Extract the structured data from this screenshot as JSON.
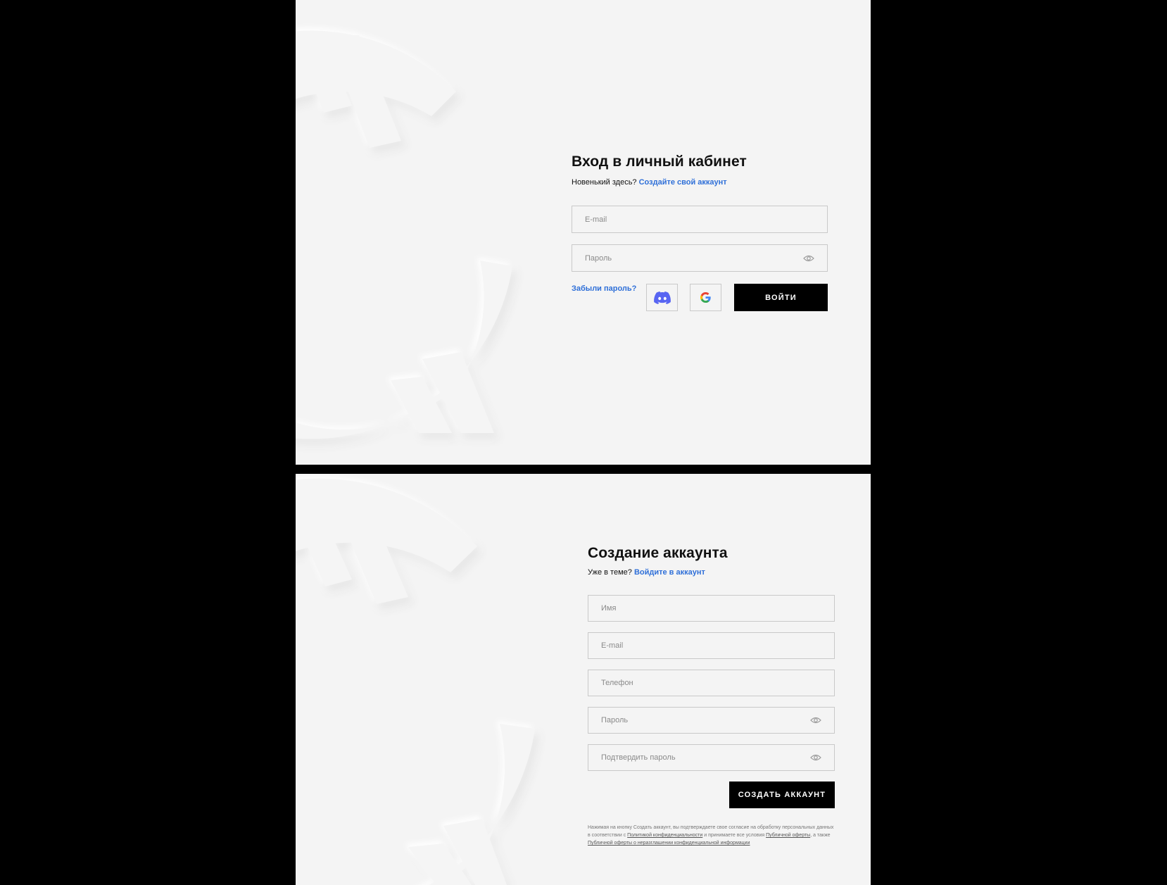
{
  "login": {
    "title": "Вход в личный кабинет",
    "subtitle_text": "Новенький здесь? ",
    "subtitle_link": "Создайте свой аккаунт",
    "email_placeholder": "E-mail",
    "password_placeholder": "Пароль",
    "forgot_link": "Забыли пароль?",
    "social_buttons": [
      "discord-icon",
      "google-icon"
    ],
    "submit_label": "ВОЙТИ"
  },
  "register": {
    "title": "Создание аккаунта",
    "subtitle_text": "Уже в теме? ",
    "subtitle_link": "Войдите в аккаунт",
    "name_placeholder": "Имя",
    "email_placeholder": "E-mail",
    "phone_placeholder": "Телефон",
    "password_placeholder": "Пароль",
    "confirm_placeholder": "Подтвердить пароль",
    "submit_label": "СОЗДАТЬ АККАУНТ",
    "legal": {
      "part1": "Нажимая на кнопку Создать аккаунт, вы подтверждаете свое согласие на обработку персональных данных в соответствии с ",
      "privacy_link": "Политикой конфиденциальности",
      "part2": " и принимаете все условия ",
      "offer_link": "Публичной оферты",
      "part3": ", а также ",
      "nda_link": "Публичной оферты о неразглашении конфиденциальной информации"
    }
  },
  "colors": {
    "panel_bg": "#f4f4f4",
    "frame_bg": "#000000",
    "link": "#2e6fd8",
    "button_bg": "#000000",
    "discord": "#5865f2"
  }
}
